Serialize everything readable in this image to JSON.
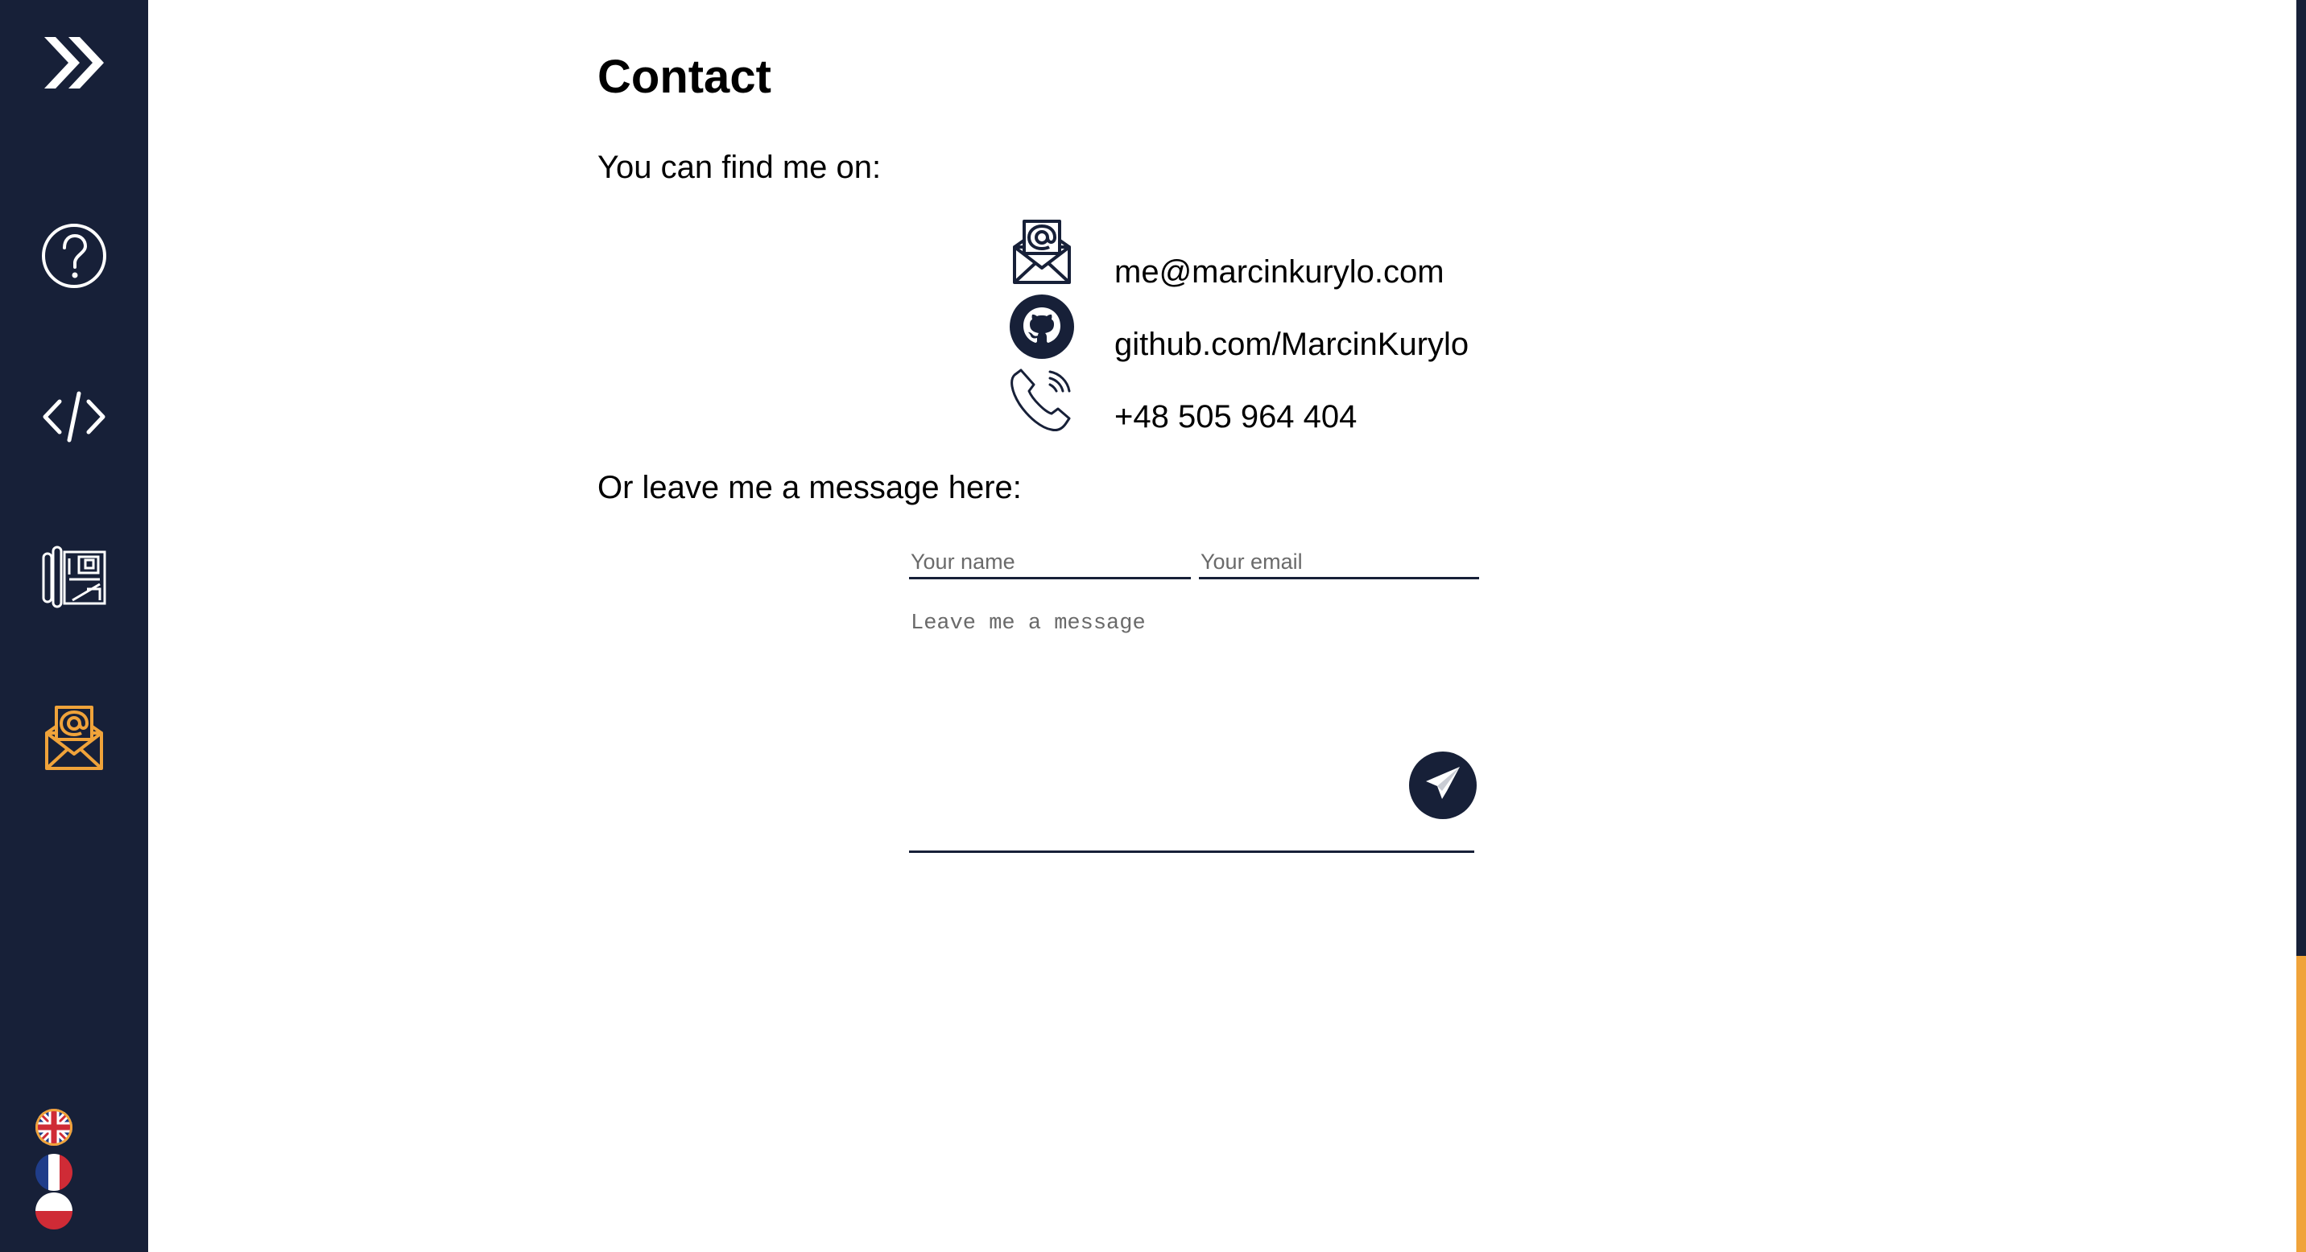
{
  "sidebar": {
    "items": [
      {
        "name": "home",
        "icon": "double-chevron-right-icon",
        "active": false
      },
      {
        "name": "about",
        "icon": "question-circle-icon",
        "active": false
      },
      {
        "name": "skills",
        "icon": "code-icon",
        "active": false
      },
      {
        "name": "projects",
        "icon": "blueprint-icon",
        "active": false
      },
      {
        "name": "contact",
        "icon": "envelope-at-icon",
        "active": true
      }
    ],
    "languages": [
      {
        "code": "en",
        "icon": "uk-flag-icon"
      },
      {
        "code": "fr",
        "icon": "france-flag-icon"
      },
      {
        "code": "pl",
        "icon": "poland-flag-icon"
      }
    ]
  },
  "page": {
    "title": "Contact",
    "find_me_text": "You can find me on:",
    "message_text": "Or leave me a message here:"
  },
  "contacts": [
    {
      "type": "email",
      "icon": "envelope-at-icon",
      "text": "me@marcinkurylo.com"
    },
    {
      "type": "github",
      "icon": "github-icon",
      "text": "github.com/MarcinKurylo"
    },
    {
      "type": "phone",
      "icon": "phone-icon",
      "text": "+48 505 964 404"
    }
  ],
  "form": {
    "name_placeholder": "Your name",
    "email_placeholder": "Your email",
    "message_placeholder": "Leave me a message",
    "send_icon": "paper-plane-icon"
  },
  "colors": {
    "sidebar_bg": "#172038",
    "accent": "#f0a33a",
    "icon_inactive": "#ffffff",
    "text": "#000000"
  }
}
